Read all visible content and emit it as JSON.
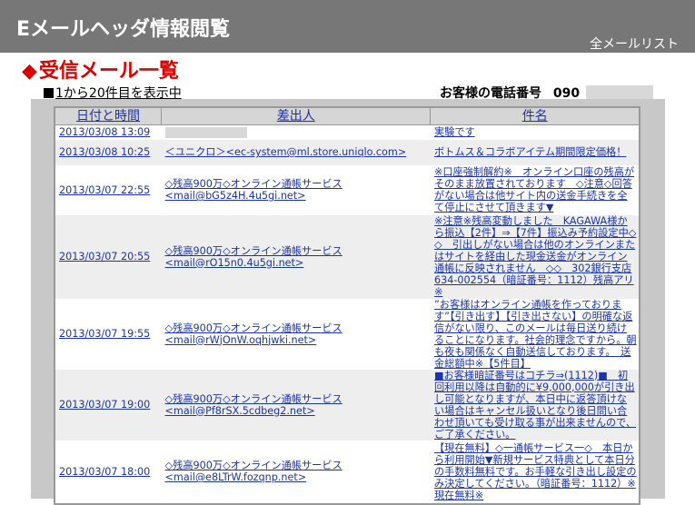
{
  "header": {
    "title": "Eメールヘッダ情報閲覧",
    "all_mail_link": "全メールリスト"
  },
  "section": {
    "title": "受信メール一覧",
    "marker": "◆"
  },
  "range_link": "1から20件目を表示中",
  "phone": {
    "label": "お客様の電話番号",
    "value_prefix": "090"
  },
  "table": {
    "headers": {
      "date": "日付と時間",
      "from": "差出人",
      "subject": "件名"
    },
    "rows": [
      {
        "date": "2013/03/08 13:09",
        "from": "",
        "subject": "実験です"
      },
      {
        "date": "2013/03/08 10:25",
        "from": "＜ユニクロ＞<ec-system@ml.store.uniqlo.com>",
        "subject": "ボトムス＆コラボアイテム期間限定価格！"
      },
      {
        "date": "2013/03/07 22:55",
        "from": "◇残高900万◇オンライン通帳サービス <mail@bG5z4H.4u5gi.net>",
        "subject": "※口座強制解約※　オンライン口座の残高がそのまま放置されております　◇注意◇回答がない場合は他サイト内の送金手続きを全て停止にさせて頂きます▼"
      },
      {
        "date": "2013/03/07 20:55",
        "from": "◇残高900万◇オンライン通帳サービス <mail@rO15n0.4u5gi.net>",
        "subject": "※注意※残高変動しました　KAGAWA様から振込【2件】⇒【7件】振込み予約設定中◇◇　引出しがない場合は他のオンラインまたはサイトを経由した現金送金がオンライン通帳に反映されません　◇◇　302銀行支店634-002554（暗証番号：1112）残高アリ※"
      },
      {
        "date": "2013/03/07 19:55",
        "from": "◇残高900万◇オンライン通帳サービス <mail@rWjOnW.oqhjwki.net>",
        "subject": "”お客様はオンライン通帳を作っております”【引き出す】【引き出さない】の明確な返信がない限り、このメールは毎日送り続けることになります。社会的理念ですから。朝も夜も関係なく自動送信しております。　送金総額中※【5件目】"
      },
      {
        "date": "2013/03/07 19:00",
        "from": "◇残高900万◇オンライン通帳サービス <mail@Pf8rSX.5cdbeg2.net>",
        "subject": "■お客様暗証番号はコチラ⇒(1112)■　初回利用以降は自動的に¥9,000,000が引き出し可能となりますが、本日中に返答頂けない場合はキャンセル扱いとなり後日問い合わせ頂いても受け取る事が出来ませんので、ご了承ください。"
      },
      {
        "date": "2013/03/07 18:00",
        "from": "◇残高900万◇オンライン通帳サービス <mail@e8LTrW.fozqnp.net>",
        "subject": "【現在無料】◇一通帳サービス一◇　本日から利用開始▼新規サービス特典として本日分の手数料無料です。お手軽な引き出し設定のみ決定してください。（暗証番号：1112）※現在無料※"
      }
    ]
  },
  "colors": {
    "header_bg": "#777777",
    "title_red": "#dd0000",
    "link_blue": "#1d33aa",
    "frame_gray": "#c8c8c8",
    "alt_row": "#eeeeee"
  }
}
